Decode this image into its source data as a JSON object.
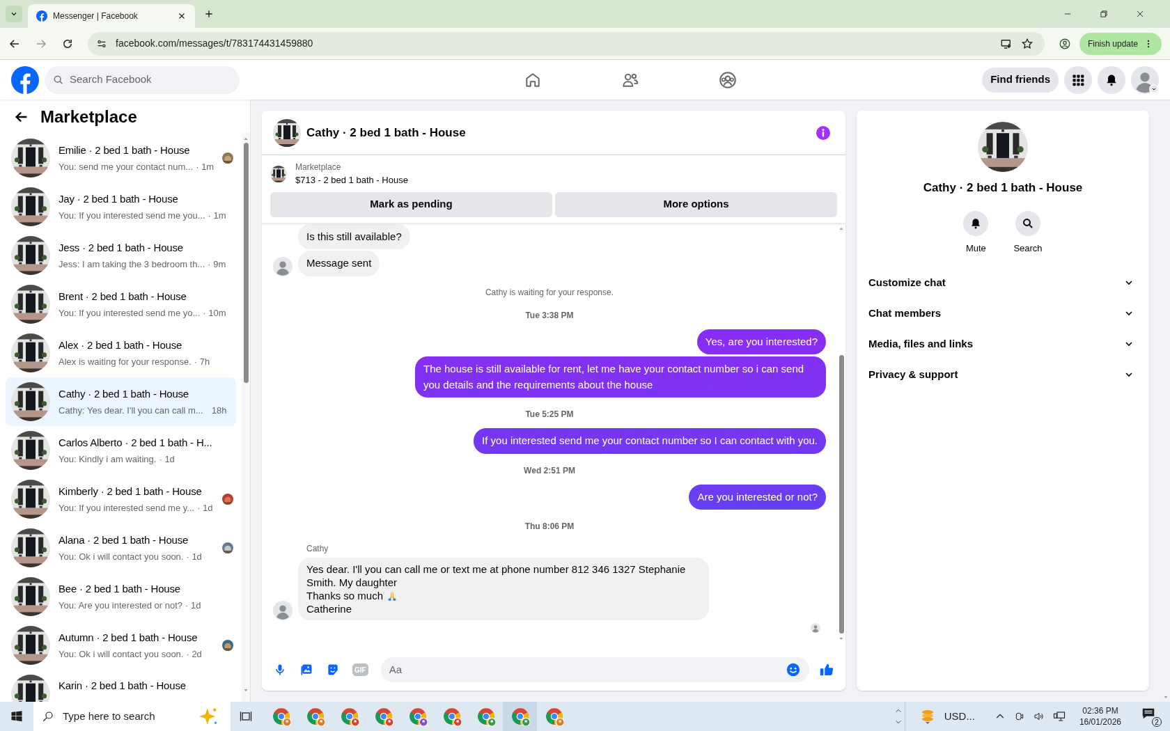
{
  "browser": {
    "tab": {
      "title": "Messenger | Facebook",
      "selected": true
    },
    "url": "facebook.com/messages/t/783174431459880",
    "update_button": "Finish update"
  },
  "header": {
    "search_placeholder": "Search Facebook",
    "find_friends": "Find friends"
  },
  "sidebar": {
    "title": "Marketplace",
    "conversations": [
      {
        "name": "Emilie · 2 bed 1 bath - House",
        "preview": "You: send me your contact num...",
        "time": "· 1m",
        "selected": false,
        "seen": true
      },
      {
        "name": "Jay · 2 bed 1 bath - House",
        "preview": "You: If you interested send me you...",
        "time": "· 1m",
        "selected": false,
        "seen": false
      },
      {
        "name": "Jess · 2 bed 1 bath - House",
        "preview": "Jess: I am taking the 3 bedroom th...",
        "time": "· 9m",
        "selected": false,
        "seen": false
      },
      {
        "name": "Brent · 2 bed 1 bath - House",
        "preview": "You: If you interested send me yo...",
        "time": "· 10m",
        "selected": false,
        "seen": false
      },
      {
        "name": "Alex · 2 bed 1 bath - House",
        "preview": "Alex is waiting for your response.",
        "time": "· 7h",
        "selected": false,
        "seen": false
      },
      {
        "name": "Cathy · 2 bed 1 bath - House",
        "preview": "Cathy: Yes dear. I'll you can call m...",
        "time": "18h",
        "selected": true,
        "seen": false
      },
      {
        "name": "Carlos Alberto · 2 bed 1 bath - H...",
        "preview": "You: Kindly i am waiting.",
        "time": "· 1d",
        "selected": false,
        "seen": false
      },
      {
        "name": "Kimberly · 2 bed 1 bath - House",
        "preview": "You: If you interested send me y...",
        "time": "· 1d",
        "selected": false,
        "seen": true
      },
      {
        "name": "Alana · 2 bed 1 bath - House",
        "preview": "You: Ok i will contact you soon.",
        "time": "· 1d",
        "selected": false,
        "seen": true
      },
      {
        "name": "Bee · 2 bed 1 bath - House",
        "preview": "You: Are you interested or not?",
        "time": "· 1d",
        "selected": false,
        "seen": false
      },
      {
        "name": "Autumn · 2 bed 1 bath - House",
        "preview": "You: Ok i will contact you soon.",
        "time": "· 2d",
        "selected": false,
        "seen": true
      },
      {
        "name": "Karin · 2 bed 1 bath - House"
      }
    ]
  },
  "chat": {
    "title": "Cathy · 2 bed 1 bath - House",
    "listing": {
      "label": "Marketplace",
      "title": "$713 - 2 bed 1 bath - House"
    },
    "buttons": [
      "Mark as pending",
      "More options"
    ],
    "messages": [
      {
        "kind": "incoming",
        "text": "Is this still available?",
        "avatar": false
      },
      {
        "kind": "incoming",
        "text": "Message sent",
        "avatar": true
      },
      {
        "kind": "note",
        "text": "Cathy is waiting for your response."
      },
      {
        "kind": "time",
        "text": "Tue 3:38 PM"
      },
      {
        "kind": "outgoing",
        "text": "Yes, are you interested?"
      },
      {
        "kind": "outgoing",
        "text": "The house is still available for rent, let me have your contact number so i can send you details and the requirements about the house"
      },
      {
        "kind": "time",
        "text": "Tue 5:25 PM"
      },
      {
        "kind": "outgoing",
        "text": "If you interested send me your contact number so I can contact with you."
      },
      {
        "kind": "time",
        "text": "Wed 2:51 PM"
      },
      {
        "kind": "outgoing",
        "text": "Are you interested or not?"
      },
      {
        "kind": "time",
        "text": "Thu 8:06 PM"
      },
      {
        "kind": "sender",
        "text": "Cathy"
      },
      {
        "kind": "incoming",
        "lines": [
          "Yes dear. I'll you can call me or text me at phone number 812 346 1327 Stephanie Smith. My daughter",
          "Thanks so much",
          "Catherine"
        ],
        "avatar": true
      }
    ],
    "composer": {
      "gif": "GIF",
      "placeholder": "Aa"
    }
  },
  "details": {
    "name": "Cathy · 2 bed 1 bath - House",
    "actions": [
      "Mute",
      "Search"
    ],
    "sections": [
      {
        "label": "Customize chat",
        "expanded": false
      },
      {
        "label": "Chat members",
        "expanded": false
      },
      {
        "label": "Media, files and links",
        "expanded": false
      },
      {
        "label": "Privacy & support",
        "expanded": false
      }
    ]
  },
  "taskbar": {
    "search_placeholder": "Type here to search",
    "tray_app": "USD...",
    "time": "02:36 PM",
    "date": "16/01/2026",
    "notifications": "2"
  }
}
